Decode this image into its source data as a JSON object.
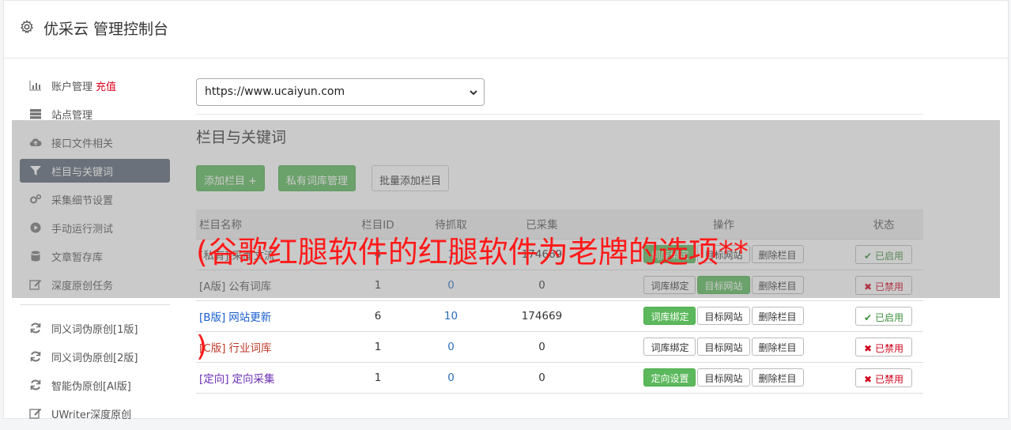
{
  "header": {
    "title": "优采云 管理控制台",
    "icon": "gear-icon"
  },
  "sidebar": {
    "items": [
      {
        "label": "账户管理",
        "extra": "充值",
        "icon": "bar-chart-icon"
      },
      {
        "label": "站点管理",
        "icon": "server-icon"
      },
      {
        "label": "接口文件相关",
        "icon": "cloud-upload-icon"
      },
      {
        "label": "栏目与关键词",
        "icon": "filter-icon",
        "active": true
      },
      {
        "label": "采集细节设置",
        "icon": "cogs-icon"
      },
      {
        "label": "手动运行测试",
        "icon": "play-circle-icon"
      },
      {
        "label": "文章暂存库",
        "icon": "database-icon"
      },
      {
        "label": "深度原创任务",
        "icon": "edit-icon"
      }
    ],
    "items2": [
      {
        "label": "同义词伪原创[1版]",
        "icon": "refresh-icon"
      },
      {
        "label": "同义词伪原创[2版]",
        "icon": "refresh-icon"
      },
      {
        "label": "智能伪原创[AI版]",
        "icon": "refresh-icon"
      },
      {
        "label": "UWriter深度原创",
        "icon": "edit-icon"
      }
    ]
  },
  "main": {
    "site_select": "https://www.ucaiyun.com",
    "section_title": "栏目与关键词",
    "buttons": {
      "add": "添加栏目 +",
      "private_lib": "私有词库管理",
      "batch_add": "批量添加栏目"
    },
    "table": {
      "headers": [
        "栏目名称",
        "栏目ID",
        "待抓取",
        "已采集",
        "操作",
        "状态"
      ],
      "rows": [
        {
          "tag": "[私有]",
          "name": "采面文流",
          "id": "4",
          "pending": "1",
          "collected": "174669",
          "op1": "词库绑定",
          "op2": "目标网站",
          "op3": "删除栏目",
          "status": "已启用"
        },
        {
          "tag": "[A版]",
          "name": "公有词库",
          "id": "1",
          "pending": "0",
          "collected": "0",
          "op1": "词库绑定",
          "op2": "目标网站",
          "op3": "删除栏目",
          "status": "已禁用"
        },
        {
          "tag": "[B版]",
          "name": "网站更新",
          "id": "6",
          "pending": "10",
          "collected": "174669",
          "op1": "词库绑定",
          "op2": "目标网站",
          "op3": "删除栏目",
          "status": "已启用"
        },
        {
          "tag": "[C版]",
          "name": "行业词库",
          "id": "1",
          "pending": "0",
          "collected": "0",
          "op1": "词库绑定",
          "op2": "目标网站",
          "op3": "删除栏目",
          "status": "已禁用"
        },
        {
          "tag": "[定向]",
          "name": "定向采集",
          "id": "1",
          "pending": "0",
          "collected": "0",
          "op1": "定向设置",
          "op2": "目标网站",
          "op3": "删除栏目",
          "status": "已禁用"
        }
      ]
    }
  },
  "watermark": {
    "line1": "(谷歌红腿软件的红腿软件为老牌的选项**",
    "line2": ")"
  },
  "colors": {
    "accent_green": "#5cb85c",
    "sidebar_active": "#5b6775",
    "enabled": "#3c8f3c",
    "disabled": "#d0021b",
    "watermark": "#ff1a1a"
  }
}
